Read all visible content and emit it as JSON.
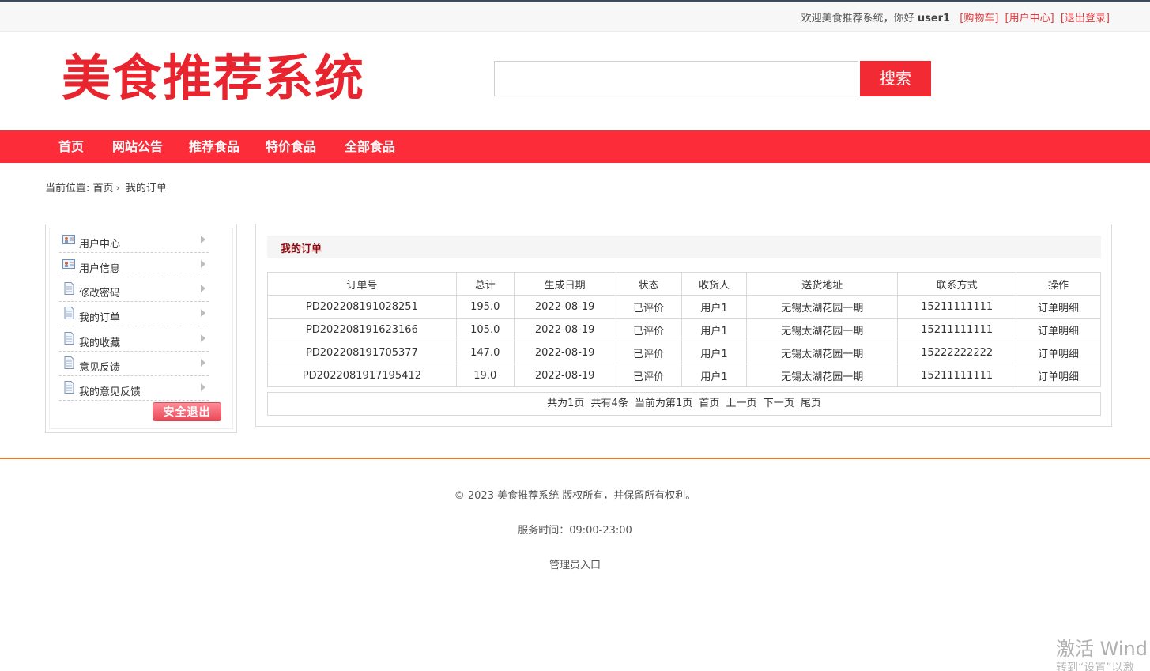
{
  "topbar": {
    "welcome": "欢迎美食推荐系统，你好",
    "username": "user1",
    "cart": "[购物车]",
    "user_center": "[用户中心]",
    "logout": "[退出登录]"
  },
  "header": {
    "logo": "美食推荐系统",
    "search_placeholder": "",
    "search_button": "搜索"
  },
  "nav": {
    "items": [
      "首页",
      "网站公告",
      "推荐食品",
      "特价食品",
      "全部食品"
    ]
  },
  "breadcrumb": {
    "prefix": "当前位置:",
    "home": "首页",
    "separator": "›",
    "current": "我的订单"
  },
  "sidebar": {
    "items": [
      {
        "label": "用户中心",
        "icon": "id-card-icon"
      },
      {
        "label": "用户信息",
        "icon": "id-card-icon"
      },
      {
        "label": "修改密码",
        "icon": "document-icon"
      },
      {
        "label": "我的订单",
        "icon": "document-icon"
      },
      {
        "label": "我的收藏",
        "icon": "document-icon"
      },
      {
        "label": "意见反馈",
        "icon": "document-icon"
      },
      {
        "label": "我的意见反馈",
        "icon": "document-icon"
      }
    ],
    "logout_button": "安全退出"
  },
  "main": {
    "title": "我的订单",
    "columns": [
      "订单号",
      "总计",
      "生成日期",
      "状态",
      "收货人",
      "送货地址",
      "联系方式",
      "操作"
    ],
    "rows": [
      [
        "PD202208191028251",
        "195.0",
        "2022-08-19",
        "已评价",
        "用户1",
        "无锡太湖花园一期",
        "15211111111",
        "订单明细"
      ],
      [
        "PD202208191623166",
        "105.0",
        "2022-08-19",
        "已评价",
        "用户1",
        "无锡太湖花园一期",
        "15211111111",
        "订单明细"
      ],
      [
        "PD202208191705377",
        "147.0",
        "2022-08-19",
        "已评价",
        "用户1",
        "无锡太湖花园一期",
        "15222222222",
        "订单明细"
      ],
      [
        "PD2022081917195412",
        "19.0",
        "2022-08-19",
        "已评价",
        "用户1",
        "无锡太湖花园一期",
        "15211111111",
        "订单明细"
      ]
    ],
    "pager": {
      "total_pages": "共为1页",
      "total_items": "共有4条",
      "current": "当前为第1页",
      "first": "首页",
      "prev": "上一页",
      "next": "下一页",
      "last": "尾页"
    }
  },
  "footer": {
    "copyright": "© 2023 美食推荐系统 版权所有，并保留所有权利。",
    "hours": "服务时间：09:00-23:00",
    "admin": "管理员入口"
  },
  "watermark": {
    "line1": "激活 Wind",
    "line2": "转到“设置”以激"
  },
  "colors": {
    "accent": "#fd2c39",
    "logo": "#e8242e",
    "panel_title": "#8b0c10",
    "footer_line": "#e8782f"
  }
}
